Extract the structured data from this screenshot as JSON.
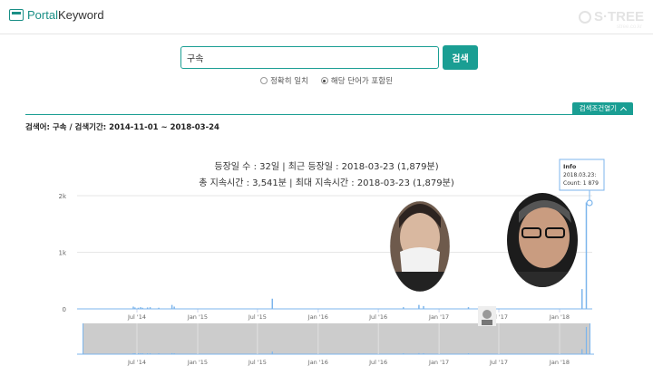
{
  "header": {
    "logo_portal": "Portal",
    "logo_keyword": "Keyword",
    "watermark": "S·TREE",
    "watermark_sub": "stree.co.kr"
  },
  "search": {
    "value": "구속",
    "button_label": "검색",
    "options": [
      {
        "label": "정확히 일치",
        "checked": false
      },
      {
        "label": "해당 단어가 포함된",
        "checked": true
      }
    ]
  },
  "condition_toggle": "검색조건열기",
  "summary": {
    "keyword_text": "검색어: 구속",
    "separator": "/",
    "period_text": "검색기간: 2014-11-01 ~ 2018-03-24"
  },
  "stats": {
    "line1": "등장일 수 : 32일 | 최근 등장일 : 2018-03-23 (1,879분)",
    "line2": "총 지속시간 : 3,541분 | 최대 지속시간 : 2018-03-23 (1,879분)"
  },
  "tooltip": {
    "title": "Info",
    "date": "2018.03.23:",
    "count": "Count: 1 879"
  },
  "chart_data": {
    "type": "bar",
    "x_range": [
      "2014-11-01",
      "2018-03-24"
    ],
    "ylim": [
      0,
      2000
    ],
    "y_ticks": [
      {
        "value": 0,
        "label": "0"
      },
      {
        "value": 1000,
        "label": "1k"
      },
      {
        "value": 2000,
        "label": "2k"
      }
    ],
    "x_ticks": [
      {
        "date": "2014-07-01",
        "label": "Jul '14"
      },
      {
        "date": "2015-01-01",
        "label": "Jan '15"
      },
      {
        "date": "2015-07-01",
        "label": "Jul '15"
      },
      {
        "date": "2016-01-01",
        "label": "Jan '16"
      },
      {
        "date": "2016-07-01",
        "label": "Jul '16"
      },
      {
        "date": "2017-01-01",
        "label": "Jan '17"
      },
      {
        "date": "2017-07-01",
        "label": "Jul '17"
      },
      {
        "date": "2018-01-01",
        "label": "Jan '18"
      }
    ],
    "series": [
      {
        "color": "#7cb5ec",
        "points": [
          {
            "date": "2014-06-20",
            "value": 40
          },
          {
            "date": "2014-06-25",
            "value": 25
          },
          {
            "date": "2014-07-05",
            "value": 20
          },
          {
            "date": "2014-07-12",
            "value": 30
          },
          {
            "date": "2014-07-18",
            "value": 20
          },
          {
            "date": "2014-08-02",
            "value": 25
          },
          {
            "date": "2014-08-10",
            "value": 30
          },
          {
            "date": "2014-09-05",
            "value": 20
          },
          {
            "date": "2014-10-15",
            "value": 70
          },
          {
            "date": "2014-10-22",
            "value": 40
          },
          {
            "date": "2015-08-15",
            "value": 180
          },
          {
            "date": "2016-09-15",
            "value": 30
          },
          {
            "date": "2016-11-01",
            "value": 70
          },
          {
            "date": "2016-11-15",
            "value": 50
          },
          {
            "date": "2017-03-31",
            "value": 30
          },
          {
            "date": "2018-03-10",
            "value": 350
          },
          {
            "date": "2018-03-23",
            "value": 1879
          }
        ]
      }
    ],
    "navigator_x_ticks": [
      "Jul '14",
      "Jan '15",
      "Jul '15",
      "Jan '16",
      "Jul '16",
      "Jan '17",
      "Jul '17",
      "Jan '18"
    ],
    "grid": true
  }
}
